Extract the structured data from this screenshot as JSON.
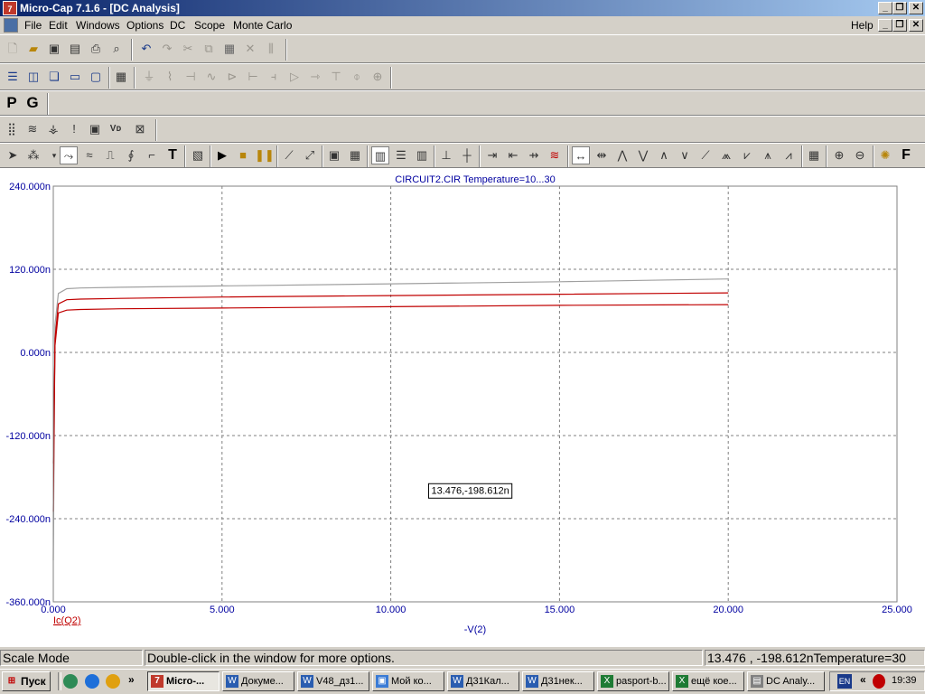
{
  "window": {
    "title": "Micro-Cap 7.1.6 - [DC Analysis]"
  },
  "menu": [
    "File",
    "Edit",
    "Windows",
    "Options",
    "DC",
    "Scope",
    "Monte Carlo"
  ],
  "menu_help": "Help",
  "toolbar_text": {
    "p": "P",
    "g": "G",
    "t": "T",
    "f": "F"
  },
  "chart_data": {
    "type": "line",
    "title": "CIRCUIT2.CIR Temperature=10...30",
    "xlabel": "-V(2)",
    "ylabel": "Ic(Q2)",
    "xlim": [
      0,
      25
    ],
    "ylim": [
      -360,
      240
    ],
    "x_ticks": [
      "0.000",
      "5.000",
      "10.000",
      "15.000",
      "20.000",
      "25.000"
    ],
    "x_tick_values": [
      0,
      5,
      10,
      15,
      20,
      25
    ],
    "y_ticks": [
      "240.000n",
      "120.000n",
      "0.000n",
      "-120.000n",
      "-240.000n",
      "-360.000n"
    ],
    "y_tick_values": [
      240,
      120,
      0,
      -120,
      -240,
      -360
    ],
    "y_unit": "n",
    "grid": true,
    "series": [
      {
        "color": "#a0a0a0",
        "x": [
          0,
          0.05,
          0.15,
          0.4,
          0.8,
          2,
          5,
          10,
          15,
          20
        ],
        "y": [
          -300,
          40,
          85,
          92,
          93,
          94,
          96,
          99,
          102,
          106
        ]
      },
      {
        "color": "#c00000",
        "x": [
          0,
          0.05,
          0.15,
          0.4,
          0.8,
          2,
          5,
          10,
          15,
          20
        ],
        "y": [
          -230,
          20,
          70,
          76,
          77,
          78,
          80,
          82,
          84,
          86
        ]
      },
      {
        "color": "#c00000",
        "x": [
          0,
          0.05,
          0.15,
          0.4,
          0.8,
          2,
          5,
          10,
          15,
          20
        ],
        "y": [
          -160,
          10,
          57,
          61,
          62,
          63,
          64,
          66,
          68,
          69
        ]
      }
    ],
    "cursor_label": "13.476,-198.612n",
    "cursor_point": [
      13.476,
      -198.612
    ]
  },
  "status": {
    "mode": "Scale Mode",
    "hint": "Double-click in the window for more options.",
    "readout": "13.476 , -198.612nTemperature=30"
  },
  "taskbar": {
    "start": "Пуск",
    "tasks": [
      "Micro-...",
      "Докуме...",
      "V48_дз1...",
      "Мой ко...",
      "Д31Кал...",
      "Д31нек...",
      "pasport-b...",
      "ещё кое...",
      "DC Analy..."
    ],
    "lang": "EN",
    "time": "19:39"
  }
}
